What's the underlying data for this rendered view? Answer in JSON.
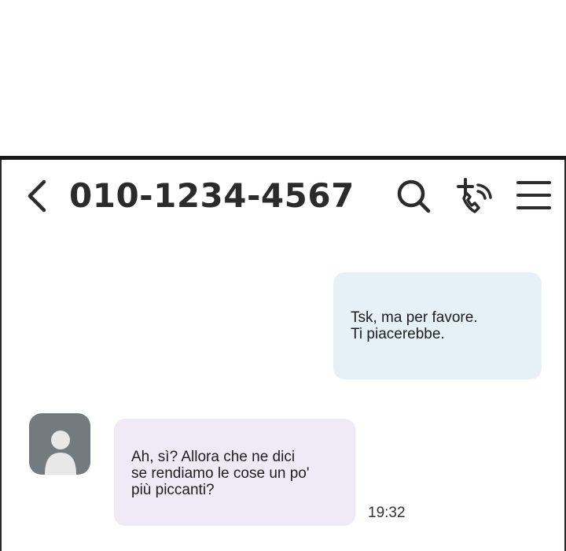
{
  "header": {
    "back_icon": "chevron-left-icon",
    "contact_number": "010-1234-4567",
    "search_icon": "search-icon",
    "call_icon": "phone-add-icon",
    "menu_icon": "hamburger-menu-icon"
  },
  "messages": [
    {
      "direction": "outgoing",
      "lines": [
        "Tsk, ma per favore.",
        "Ti piacerebbe."
      ]
    },
    {
      "direction": "incoming",
      "lines": [
        "Ah, sì? Allora che ne dici",
        "se rendiamo le cose un po'",
        "più piccanti?"
      ],
      "time": "19:32"
    }
  ],
  "colors": {
    "outgoing_bubble": "#e6f1f7",
    "incoming_bubble": "#efeaf5",
    "avatar_bg": "#747b7e",
    "frame": "#1a1a1a"
  }
}
